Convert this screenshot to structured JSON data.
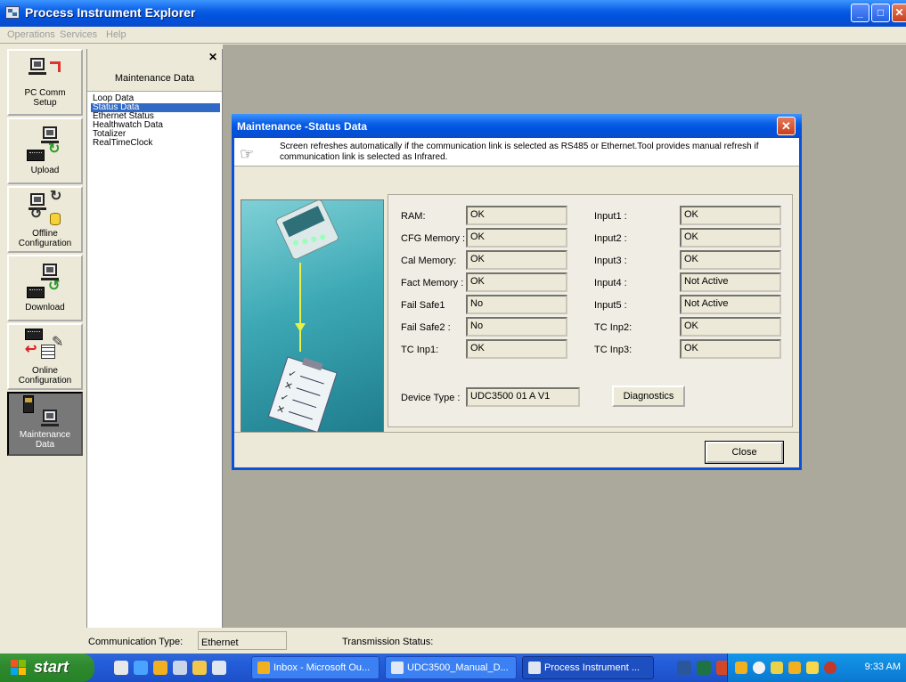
{
  "window": {
    "title": "Process Instrument Explorer"
  },
  "menu": [
    "Operations",
    "Services",
    "Help"
  ],
  "toolbar": [
    {
      "label_line1": "PC Comm",
      "label_line2": "Setup"
    },
    {
      "label_line1": "Upload",
      "label_line2": ""
    },
    {
      "label_line1": "Offline",
      "label_line2": "Configuration"
    },
    {
      "label_line1": "Download",
      "label_line2": ""
    },
    {
      "label_line1": "Online",
      "label_line2": "Configuration"
    },
    {
      "label_line1": "Maintenance",
      "label_line2": "Data"
    }
  ],
  "maintenance_panel": {
    "heading": "Maintenance Data",
    "items": [
      "Loop Data",
      "Status Data",
      "Ethernet Status",
      "Healthwatch Data",
      "Totalizer",
      "RealTimeClock"
    ],
    "selected": "Status Data"
  },
  "dialog": {
    "title": "Maintenance -Status Data",
    "info": "Screen refreshes automatically if the communication link is selected as RS485 or Ethernet.Tool provides manual refresh if communication link is selected as Infrared.",
    "left_fields": [
      {
        "label": "RAM:",
        "value": "OK"
      },
      {
        "label": "CFG Memory :",
        "value": "OK"
      },
      {
        "label": "Cal Memory:",
        "value": "OK"
      },
      {
        "label": "Fact Memory :",
        "value": "OK"
      },
      {
        "label": "Fail Safe1",
        "value": "No"
      },
      {
        "label": "Fail Safe2 :",
        "value": "No"
      },
      {
        "label": "TC Inp1:",
        "value": "OK"
      }
    ],
    "right_fields": [
      {
        "label": "Input1 :",
        "value": "OK"
      },
      {
        "label": "Input2 :",
        "value": "OK"
      },
      {
        "label": "Input3 :",
        "value": "OK"
      },
      {
        "label": "Input4 :",
        "value": "Not Active"
      },
      {
        "label": "Input5 :",
        "value": "Not Active"
      },
      {
        "label": "TC Inp2:",
        "value": "OK"
      },
      {
        "label": "TC Inp3:",
        "value": "OK"
      }
    ],
    "device_type_label": "Device Type :",
    "device_type_value": "UDC3500  01 A  V1",
    "diagnostics_label": "Diagnostics",
    "close_label": "Close"
  },
  "statusbar": {
    "comm_type_label": "Communication Type:",
    "comm_type_value": "Ethernet",
    "transmission_label": "Transmission Status:"
  },
  "taskbar": {
    "start_label": "start",
    "tasks": [
      "Inbox - Microsoft Ou...",
      "UDC3500_Manual_D...",
      "Process Instrument ..."
    ],
    "clock": "9:33 AM"
  },
  "colors": {
    "titlebar_blue": "#0053de",
    "selection_blue": "#316ac5",
    "start_green": "#2f8a2f",
    "mdi_background": "#aba89c",
    "dialog_image_teal": "#3da9b5"
  }
}
